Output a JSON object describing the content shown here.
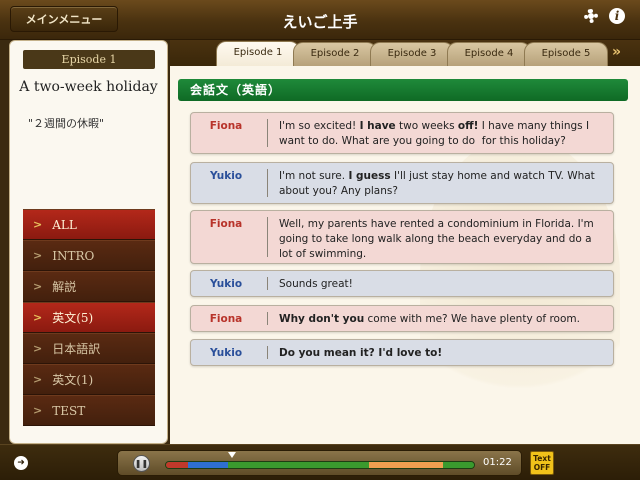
{
  "header": {
    "menu_button": "メインメニュー",
    "app_title": "えいご上手"
  },
  "tabs": [
    {
      "label": "Episode 1",
      "active": true
    },
    {
      "label": "Episode 2",
      "active": false
    },
    {
      "label": "Episode 3",
      "active": false
    },
    {
      "label": "Episode 4",
      "active": false
    },
    {
      "label": "Episode 5",
      "active": false
    }
  ],
  "tabs_more": "»",
  "sidebar": {
    "episode_badge": "Episode 1",
    "title": "A two-week holiday",
    "subtitle": "\"２週間の休暇\"",
    "items": [
      {
        "label": "ALL",
        "highlighted": true
      },
      {
        "label": "INTRO",
        "highlighted": false
      },
      {
        "label": "解説",
        "highlighted": false
      },
      {
        "label": "英文(5)",
        "highlighted": true
      },
      {
        "label": "日本語訳",
        "highlighted": false
      },
      {
        "label": "英文(1)",
        "highlighted": false
      },
      {
        "label": "TEST",
        "highlighted": false
      }
    ]
  },
  "section": {
    "title": "会話文（英語）"
  },
  "dialogue": [
    {
      "speaker": "Fiona",
      "role": "fiona",
      "html": "I'm so excited! <b>I have</b> two weeks <b>off!</b> I have many things I want to do. What are you going to do &nbsp;for this holiday?"
    },
    {
      "speaker": "Yukio",
      "role": "yukio",
      "html": "I'm not sure. <b>I guess</b> I'll just stay home and watch TV. What about you? Any plans?"
    },
    {
      "speaker": "Fiona",
      "role": "fiona",
      "html": "Well, my parents have rented a condominium in Florida. I'm going to take long walk along the beach everyday and do a lot of swimming."
    },
    {
      "speaker": "Yukio",
      "role": "yukio",
      "html": "Sounds great!"
    },
    {
      "speaker": "Fiona",
      "role": "fiona",
      "html": "<b>Why don't you</b> come with me? We have plenty of room."
    },
    {
      "speaker": "Yukio",
      "role": "yukio",
      "html": "<b>Do you mean it? I'd love to!</b>"
    }
  ],
  "player": {
    "time": "01:22",
    "text_toggle_line1": "Text",
    "text_toggle_line2": "OFF",
    "segments": [
      {
        "color": "#c0392b",
        "from": 0.0,
        "to": 0.07
      },
      {
        "color": "#2e6fd0",
        "from": 0.07,
        "to": 0.2
      },
      {
        "color": "#3a9a2e",
        "from": 0.2,
        "to": 0.66
      },
      {
        "color": "#f0a050",
        "from": 0.66,
        "to": 0.9
      },
      {
        "color": "#3a9a2e",
        "from": 0.9,
        "to": 1.0
      }
    ]
  },
  "colors": {
    "section_green": "#1f8a3a",
    "fiona_red": "#b8332a",
    "yukio_blue": "#2a4f9a",
    "menu_highlight": "#b3281a"
  }
}
